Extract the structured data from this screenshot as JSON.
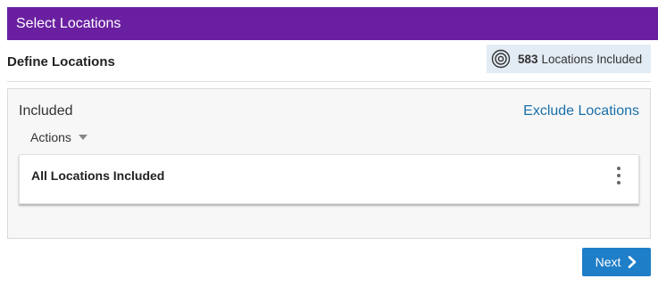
{
  "header": {
    "title": "Select Locations"
  },
  "section": {
    "title": "Define Locations"
  },
  "summary": {
    "count": "583",
    "label": "Locations Included",
    "icon": "target-icon"
  },
  "panel": {
    "title": "Included",
    "exclude_link": "Exclude Locations",
    "actions_label": "Actions",
    "card_label": "All Locations Included"
  },
  "footer": {
    "next_label": "Next"
  },
  "colors": {
    "header_bg": "#6a1fa0",
    "chip_bg": "#e3ecf4",
    "link": "#1a6fa8",
    "primary_button": "#1e7ec8"
  }
}
